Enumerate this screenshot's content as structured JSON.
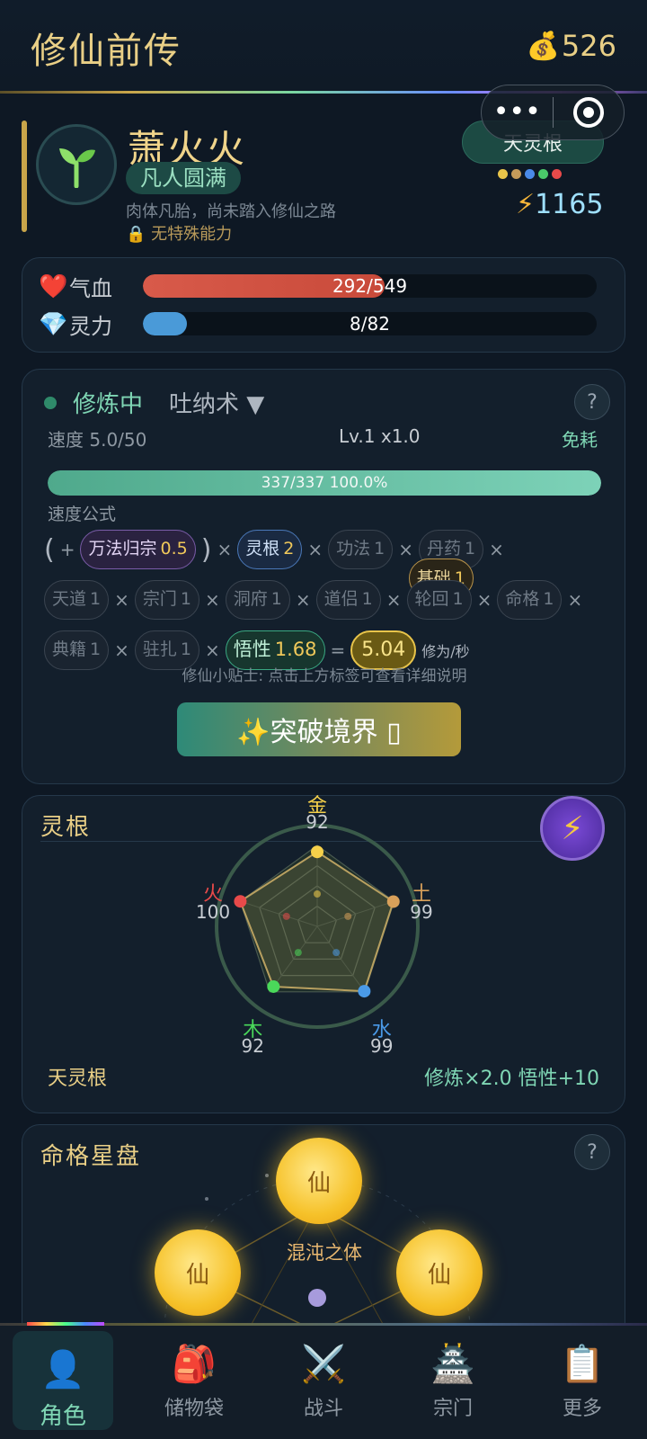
{
  "header": {
    "title": "修仙前传",
    "gold_icon": "money-bag-icon",
    "gold": "526"
  },
  "profile": {
    "name": "萧火火",
    "realm": "凡人圆满",
    "realm_desc": "肉体凡胎，尚未踏入修仙之路",
    "ability": "无特殊能力",
    "root_badge": "天灵根",
    "root_dot_colors": [
      "#e8c44a",
      "#c49a5a",
      "#4a8ae8",
      "#4ac86a",
      "#e84a4a"
    ],
    "power": "1165"
  },
  "stats": {
    "hp": {
      "label": "气血",
      "text": "292/549",
      "fraction": 0.532,
      "color": "#d85a4a"
    },
    "mp": {
      "label": "灵力",
      "text": "8/82",
      "fraction": 0.098,
      "color": "#4a9ad8"
    }
  },
  "cultivation": {
    "status": "修炼中",
    "method": "吐纳术 ▼",
    "help": "?",
    "speed": "速度 5.0/50",
    "level": "Lv.1 x1.0",
    "cost": "免耗",
    "progress_text": "337/337  100.0%",
    "progress": 1.0,
    "formula_title": "速度公式",
    "chips": {
      "base": {
        "name": "基础",
        "value": "1"
      },
      "wanfa": {
        "name": "万法归宗",
        "value": "0.5"
      },
      "root": {
        "name": "灵根",
        "value": "2"
      },
      "gongfa": {
        "name": "功法",
        "value": "1"
      },
      "danyao": {
        "name": "丹药",
        "value": "1"
      },
      "tiandao": {
        "name": "天道",
        "value": "1"
      },
      "zongmen": {
        "name": "宗门",
        "value": "1"
      },
      "dongfu": {
        "name": "洞府",
        "value": "1"
      },
      "daolv": {
        "name": "道侣",
        "value": "1"
      },
      "lunhui": {
        "name": "轮回",
        "value": "1"
      },
      "mingge": {
        "name": "命格",
        "value": "1"
      },
      "dianji": {
        "name": "典籍",
        "value": "1"
      },
      "zhuzha": {
        "name": "驻扎",
        "value": "1"
      },
      "wuxing": {
        "name": "悟性",
        "value": "1.68"
      }
    },
    "ops": {
      "plus": "+",
      "times": "×",
      "equals": "=",
      "open": "(",
      "close": ")"
    },
    "result": "5.04",
    "unit": "修为/秒",
    "tip": "修仙小贴士: 点击上方标签可查看详细说明",
    "breakthrough": "✨突破境界 ▯"
  },
  "spirit_root": {
    "title": "灵根",
    "elements": [
      {
        "label": "金",
        "value": "92",
        "color": "#f5d04a"
      },
      {
        "label": "土",
        "value": "99",
        "color": "#d8a05a"
      },
      {
        "label": "水",
        "value": "99",
        "color": "#4a9ae8"
      },
      {
        "label": "木",
        "value": "92",
        "color": "#4ad85a"
      },
      {
        "label": "火",
        "value": "100",
        "color": "#e84a4a"
      }
    ],
    "name": "天灵根",
    "bonus": "修炼×2.0  悟性+10"
  },
  "star_disk": {
    "title": "命格星盘",
    "help": "?",
    "sun_label": "仙",
    "destiny": "混沌之体"
  },
  "nav": [
    {
      "label": "角色",
      "icon": "👤",
      "icon_name": "person-icon"
    },
    {
      "label": "储物袋",
      "icon": "🎒",
      "icon_name": "backpack-icon"
    },
    {
      "label": "战斗",
      "icon": "⚔️",
      "icon_name": "crossed-swords-icon"
    },
    {
      "label": "宗门",
      "icon": "🏯",
      "icon_name": "castle-icon"
    },
    {
      "label": "更多",
      "icon": "📋",
      "icon_name": "clipboard-icon"
    }
  ]
}
